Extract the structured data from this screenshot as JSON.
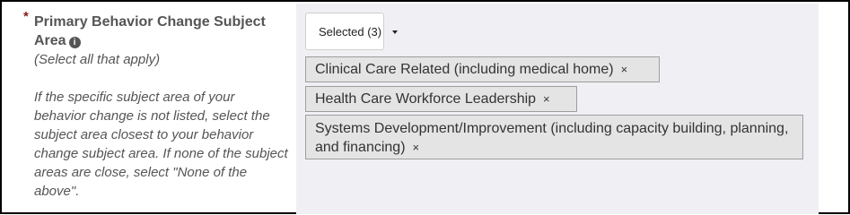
{
  "field": {
    "required_marker": "*",
    "title": "Primary Behavior Change Subject Area",
    "info_icon": "info-circle-icon",
    "instruction": "(Select all that apply)",
    "help_text": "If the specific subject area of your behavior change is not listed, select the subject area closest to your behavior change subject area. If none of the subject areas are close, select \"None of the above\"."
  },
  "dropdown": {
    "label": "Selected (3)",
    "icon": "caret-down-icon"
  },
  "selected_tags": [
    {
      "label": "Clinical Care Related (including medical home)",
      "remove": "×"
    },
    {
      "label": "Health Care Workforce Leadership",
      "remove": "×"
    },
    {
      "label": "Systems Development/Improvement (including capacity building, planning, and financing)",
      "remove": "×"
    }
  ],
  "colors": {
    "required_star": "#8a1a1a",
    "label_text": "#555555",
    "panel_background": "#f0f0f4",
    "tag_background": "#e4e4e4"
  }
}
